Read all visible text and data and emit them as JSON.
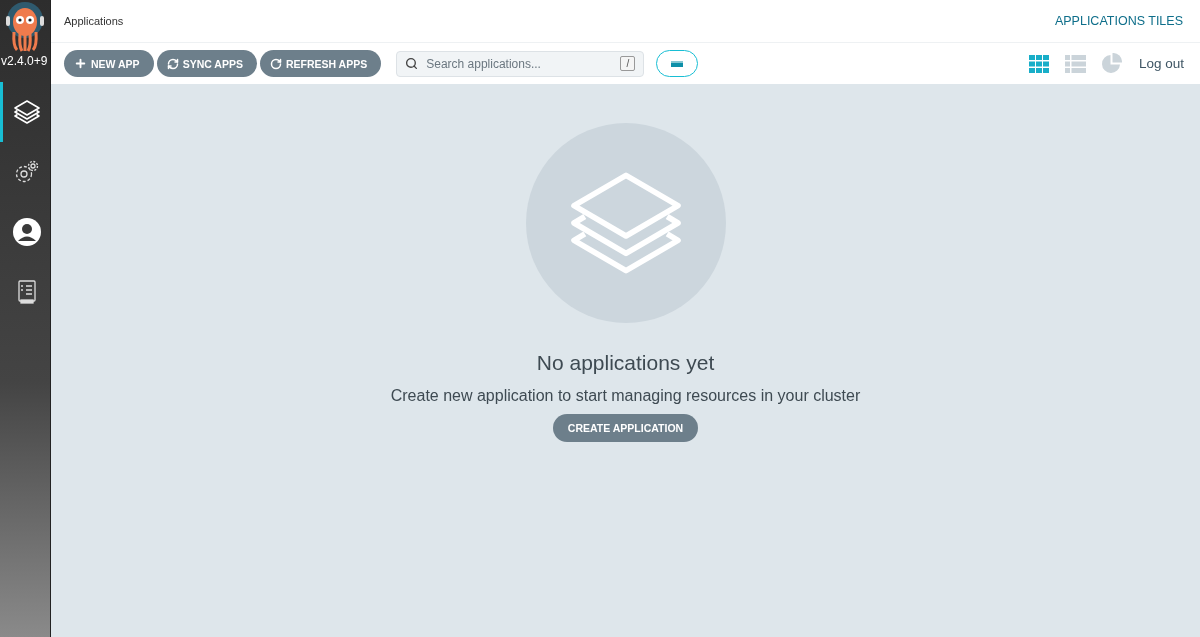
{
  "sidebar": {
    "version": "v2.4.0+9",
    "items": [
      {
        "kind": "applications",
        "selected": true
      },
      {
        "kind": "settings",
        "selected": false
      },
      {
        "kind": "user",
        "selected": false
      },
      {
        "kind": "docs",
        "selected": false
      }
    ]
  },
  "header": {
    "title": "Applications",
    "view_title": "APPLICATIONS TILES"
  },
  "toolbar": {
    "buttons": [
      {
        "kind": "new",
        "label": "NEW APP"
      },
      {
        "kind": "sync",
        "label": "SYNC APPS"
      },
      {
        "kind": "refresh",
        "label": "REFRESH APPS"
      }
    ],
    "search": {
      "placeholder": "Search applications...",
      "shortcut": "/"
    },
    "view_modes": [
      {
        "kind": "tiles",
        "selected": true
      },
      {
        "kind": "list",
        "selected": false
      },
      {
        "kind": "summary",
        "selected": false
      }
    ],
    "logout": "Log out"
  },
  "empty_state": {
    "title": "No applications yet",
    "message": "Create new application to start managing resources in your cluster",
    "button": "CREATE APPLICATION"
  }
}
